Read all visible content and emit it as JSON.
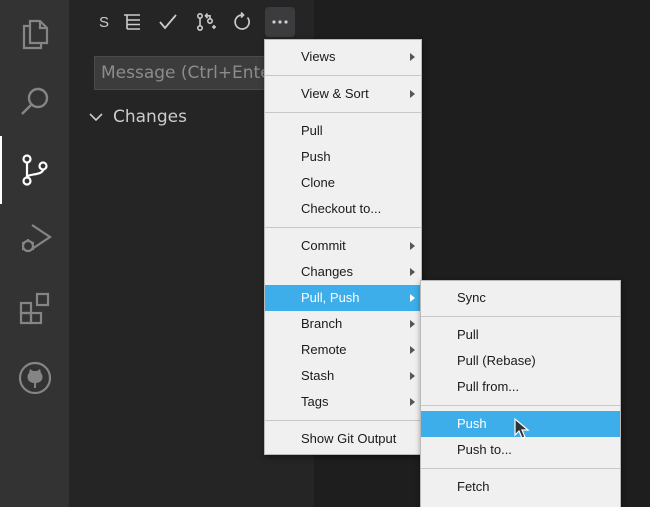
{
  "activity_bar": {
    "items": [
      {
        "name": "explorer",
        "icon": "files-icon"
      },
      {
        "name": "search",
        "icon": "search-icon"
      },
      {
        "name": "source-control",
        "icon": "source-control-icon",
        "active": true
      },
      {
        "name": "run-debug",
        "icon": "run-debug-icon"
      },
      {
        "name": "extensions",
        "icon": "extensions-icon"
      },
      {
        "name": "github",
        "icon": "github-icon"
      }
    ]
  },
  "toolbar": {
    "stage_label": "S",
    "icons": [
      "view-as-tree-icon",
      "commit-check-icon",
      "create-pull-request-icon",
      "refresh-icon",
      "more-actions-icon"
    ]
  },
  "commit_input": {
    "placeholder": "Message (Ctrl+Enter"
  },
  "changes": {
    "label": "Changes"
  },
  "main_menu": {
    "items": [
      {
        "label": "Views",
        "submenu": true
      },
      {
        "label": "View & Sort",
        "submenu": true
      },
      {
        "label": "Pull"
      },
      {
        "label": "Push"
      },
      {
        "label": "Clone"
      },
      {
        "label": "Checkout to..."
      },
      {
        "label": "Commit",
        "submenu": true
      },
      {
        "label": "Changes",
        "submenu": true
      },
      {
        "label": "Pull, Push",
        "submenu": true,
        "highlighted": true
      },
      {
        "label": "Branch",
        "submenu": true
      },
      {
        "label": "Remote",
        "submenu": true
      },
      {
        "label": "Stash",
        "submenu": true
      },
      {
        "label": "Tags",
        "submenu": true
      },
      {
        "label": "Show Git Output"
      }
    ]
  },
  "sub_menu": {
    "items": [
      {
        "label": "Sync"
      },
      {
        "label": "Pull"
      },
      {
        "label": "Pull (Rebase)"
      },
      {
        "label": "Pull from..."
      },
      {
        "label": "Push",
        "highlighted": true
      },
      {
        "label": "Push to..."
      },
      {
        "label": "Fetch"
      }
    ]
  },
  "colors": {
    "highlight": "#3daee9",
    "activity_bar_bg": "#333333",
    "sidebar_bg": "#252526",
    "menu_bg": "#f0f0f0"
  }
}
